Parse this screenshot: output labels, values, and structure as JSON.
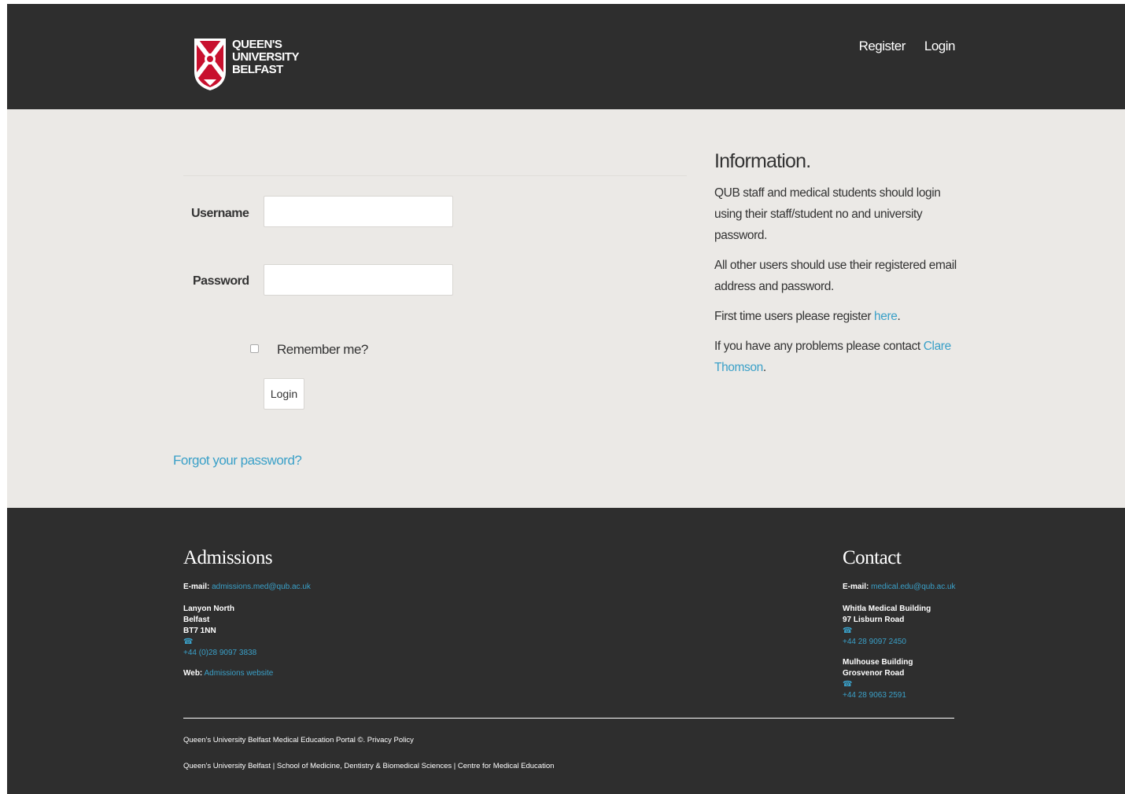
{
  "header": {
    "logo_lines": [
      "QUEEN'S",
      "UNIVERSITY",
      "BELFAST"
    ],
    "nav": [
      {
        "label": "Register"
      },
      {
        "label": "Login"
      }
    ]
  },
  "login_form": {
    "username_label": "Username",
    "username_value": "",
    "password_label": "Password",
    "password_value": "",
    "remember_label": "Remember me?",
    "remember_checked": false,
    "submit_label": "Login",
    "forgot_link": "Forgot your password?"
  },
  "information": {
    "title": "Information.",
    "p1": "QUB staff and medical students should login using their staff/student no and university password.",
    "p2": "All other users should use their registered email address and password.",
    "p3_text": "First time users please register ",
    "p3_link": "here",
    "p3_end": ".",
    "p4_text": "If you have any problems please contact ",
    "p4_link": "Clare Thomson",
    "p4_end": "."
  },
  "footer": {
    "admissions": {
      "heading": "Admissions",
      "email_label": "E-mail:",
      "email": "admissions.med@qub.ac.uk",
      "address": [
        "Lanyon North",
        "Belfast",
        "BT7 1NN"
      ],
      "phone": "+44 (0)28 9097 3838",
      "web_label": "Web:",
      "web_link": "Admissions website"
    },
    "contact": {
      "heading": "Contact",
      "email_label": "E-mail:",
      "email": "medical.edu@qub.ac.uk",
      "building1": [
        "Whitla Medical Building",
        "97 Lisburn Road"
      ],
      "phone1": "+44 28 9097 2450",
      "building2": [
        "Mulhouse Building",
        "Grosvenor Road"
      ],
      "phone2": "+44 28 9063 2591"
    },
    "legal_line1": "Queen's University Belfast Medical Education Portal ©. Privacy Policy",
    "legal_line2": "Queen's University Belfast | School of Medicine, Dentistry & Biomedical Sciences | Centre for Medical Education"
  },
  "colors": {
    "header_bg": "#2e2e2e",
    "main_bg": "#ebe9e6",
    "link": "#3aa0c8",
    "crest_red": "#c8102e"
  }
}
